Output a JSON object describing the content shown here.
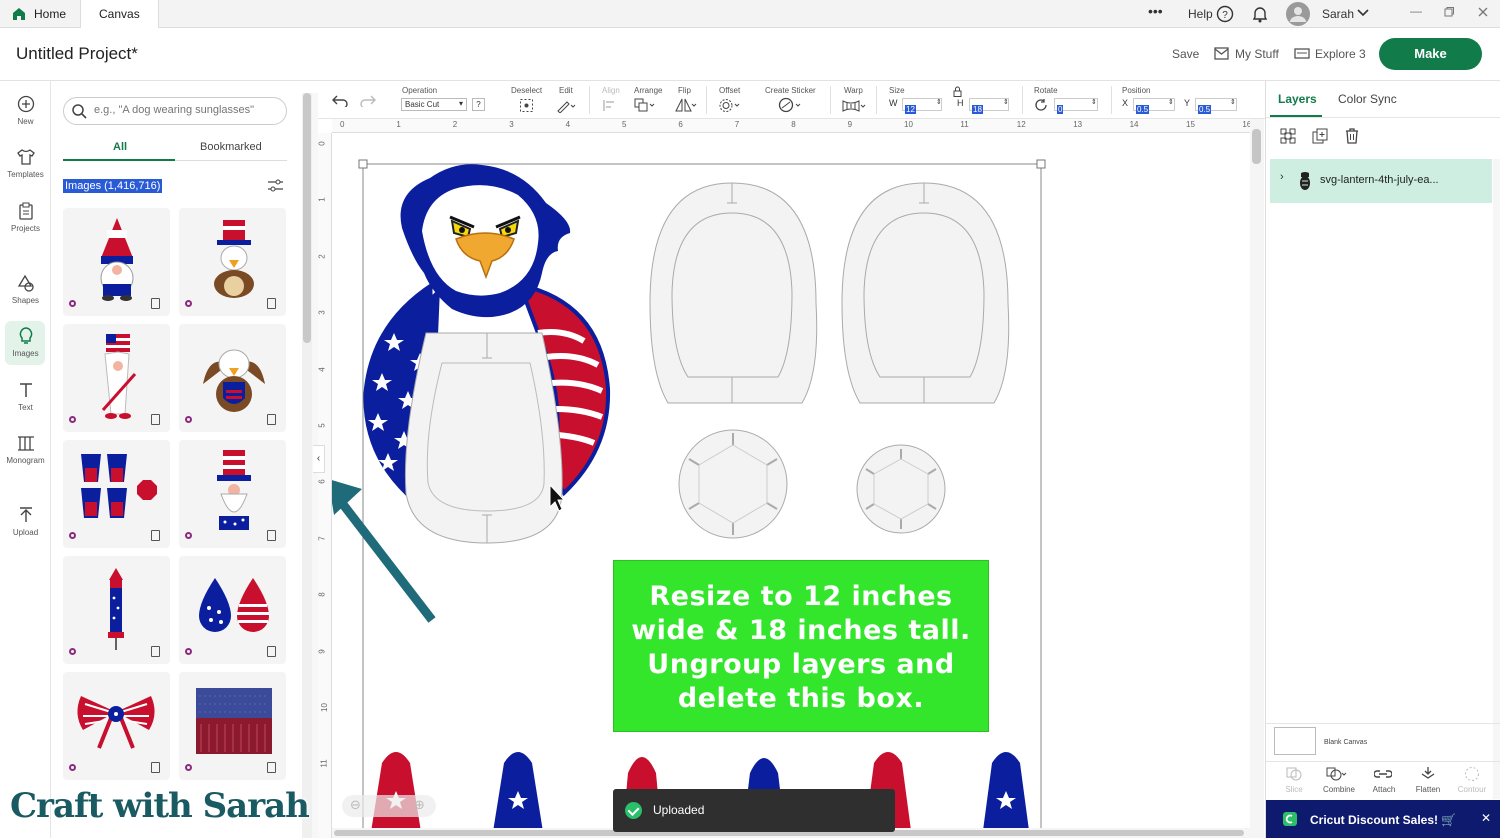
{
  "tabs": {
    "home": "Home",
    "canvas": "Canvas"
  },
  "topbar": {
    "more": "•••",
    "help": "Help",
    "user": "Sarah"
  },
  "header": {
    "project_title": "Untitled Project*",
    "save": "Save",
    "my_stuff": "My Stuff",
    "machine": "Explore 3",
    "make": "Make"
  },
  "rail": [
    "New",
    "Templates",
    "Projects",
    "Shapes",
    "Images",
    "Text",
    "Monogram",
    "Upload"
  ],
  "panel": {
    "search_placeholder": "e.g., \"A dog wearing sunglasses\"",
    "tab_all": "All",
    "tab_bookmarked": "Bookmarked",
    "results": "Images (1,416,716)"
  },
  "toolbar": {
    "operation_label": "Operation",
    "operation_value": "Basic Cut",
    "deselect": "Deselect",
    "edit": "Edit",
    "align": "Align",
    "arrange": "Arrange",
    "flip": "Flip",
    "offset": "Offset",
    "create_sticker": "Create Sticker",
    "warp": "Warp",
    "size": "Size",
    "w_label": "W",
    "w_value": "12",
    "h_label": "H",
    "h_value": "18",
    "rotate": "Rotate",
    "rotate_value": "0",
    "position": "Position",
    "x_label": "X",
    "x_value": "0.5",
    "y_label": "Y",
    "y_value": "0.5"
  },
  "ruler_top": [
    "0",
    "1",
    "2",
    "3",
    "4",
    "5",
    "6",
    "7",
    "8",
    "9",
    "10",
    "11",
    "12",
    "13",
    "14",
    "15",
    "16"
  ],
  "ruler_left": [
    "0",
    "1",
    "2",
    "3",
    "4",
    "5",
    "6",
    "7",
    "8",
    "9",
    "10",
    "11"
  ],
  "canvas": {
    "instruction": "Resize to 12 inches wide & 18 inches tall. Ungroup layers and delete this box."
  },
  "toast": "Uploaded",
  "right_panel": {
    "tab_layers": "Layers",
    "tab_color_sync": "Color Sync",
    "layer_name": "svg-lantern-4th-july-ea...",
    "blank_canvas": "Blank Canvas",
    "bottom_tools": [
      "Slice",
      "Combine",
      "Attach",
      "Flatten",
      "Contour"
    ],
    "promo": "Cricut Discount Sales! 🛒"
  },
  "watermark": "Craft with Sarah",
  "colors": {
    "brand_green": "#127b4a",
    "red": "#c8102e",
    "blue": "#0b1f9e",
    "note_green": "#33e62b"
  }
}
